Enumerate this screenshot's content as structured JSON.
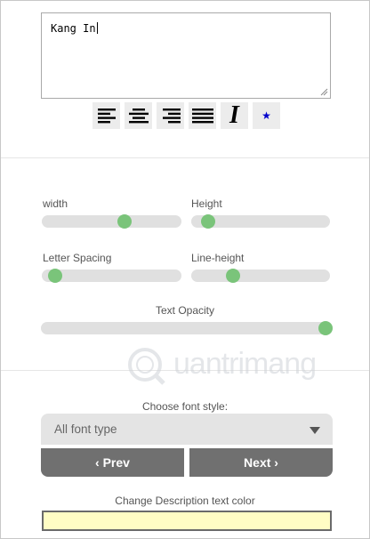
{
  "editor": {
    "text": "Kang In"
  },
  "toolbar": {
    "buttons": [
      {
        "icon": "align-left-icon"
      },
      {
        "icon": "align-center-icon"
      },
      {
        "icon": "align-right-icon"
      },
      {
        "icon": "align-justify-icon"
      },
      {
        "icon": "italic-icon",
        "glyph": "I"
      },
      {
        "icon": "star-icon",
        "glyph": "★",
        "color": "#0000cc"
      }
    ]
  },
  "sliders": {
    "width": {
      "label": "width",
      "value": 0.6
    },
    "height": {
      "label": "Height",
      "value": 0.08
    },
    "letter_spacing": {
      "label": "Letter Spacing",
      "value": 0.05
    },
    "line_height": {
      "label": "Line-height",
      "value": 0.28
    },
    "text_opacity": {
      "label": "Text Opacity",
      "value": 1.0
    }
  },
  "font": {
    "label": "Choose font style:",
    "selected": "All font type"
  },
  "nav": {
    "prev": "‹ Prev",
    "next": "Next ›"
  },
  "color": {
    "label": "Change Description text color",
    "value": "#fffdc4"
  },
  "watermark": {
    "text": "uantrimang"
  },
  "colors": {
    "knob": "#7ac47a",
    "track": "#e0e0e0",
    "button": "#707070"
  }
}
